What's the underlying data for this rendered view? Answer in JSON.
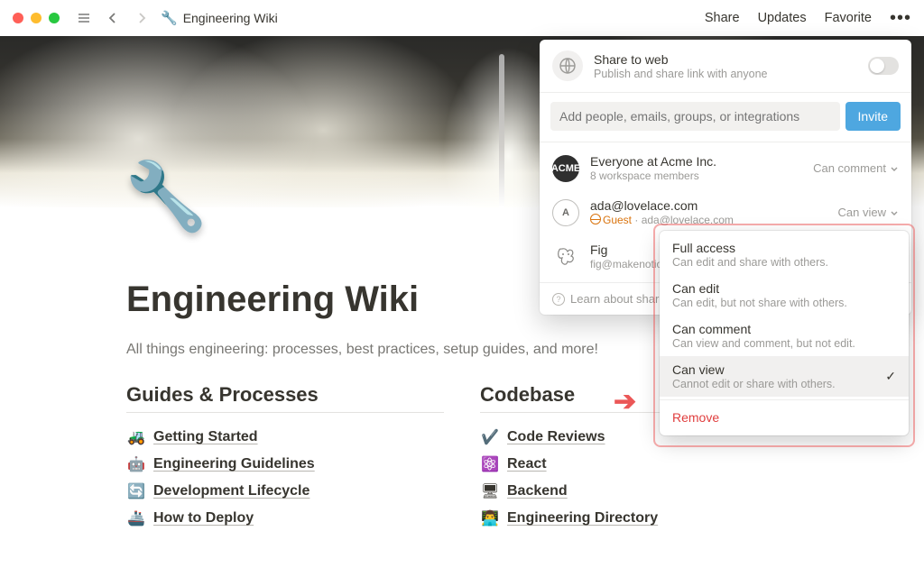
{
  "window": {
    "title": "Engineering Wiki"
  },
  "top_actions": {
    "share": "Share",
    "updates": "Updates",
    "favorite": "Favorite"
  },
  "page": {
    "title": "Engineering Wiki",
    "subtitle": "All things engineering: processes, best practices, setup guides, and more!"
  },
  "columns": {
    "left": {
      "heading": "Guides & Processes",
      "items": [
        {
          "emoji": "🚜",
          "label": "Getting Started"
        },
        {
          "emoji": "🤖",
          "label": "Engineering Guidelines"
        },
        {
          "emoji": "🔄",
          "label": "Development Lifecycle"
        },
        {
          "emoji": "🚢",
          "label": "How to Deploy"
        }
      ]
    },
    "right": {
      "heading": "Codebase",
      "items": [
        {
          "emoji": "✔️",
          "label": "Code Reviews"
        },
        {
          "emoji": "⚛️",
          "label": "React"
        },
        {
          "emoji": "🖥",
          "label": "Backend"
        },
        {
          "emoji": "👨‍💻",
          "label": "Engineering Directory"
        }
      ]
    }
  },
  "share_popover": {
    "web": {
      "title": "Share to web",
      "subtitle": "Publish and share link with anyone"
    },
    "invite": {
      "placeholder": "Add people, emails, groups, or integrations",
      "button": "Invite"
    },
    "entries": [
      {
        "avatar": "ACME",
        "name": "Everyone at Acme Inc.",
        "sub": "8 workspace members",
        "perm": "Can comment"
      },
      {
        "avatar": "A",
        "name": "ada@lovelace.com",
        "guest": "Guest",
        "sub_email": "ada@lovelace.com",
        "perm": "Can view"
      },
      {
        "avatar": "fig",
        "name": "Fig",
        "sub": "fig@makenotion.com",
        "perm": ""
      }
    ],
    "learn": "Learn about sharing"
  },
  "perm_menu": {
    "options": [
      {
        "title": "Full access",
        "desc": "Can edit and share with others."
      },
      {
        "title": "Can edit",
        "desc": "Can edit, but not share with others."
      },
      {
        "title": "Can comment",
        "desc": "Can view and comment, but not edit."
      },
      {
        "title": "Can view",
        "desc": "Cannot edit or share with others.",
        "selected": true
      }
    ],
    "remove": "Remove"
  }
}
